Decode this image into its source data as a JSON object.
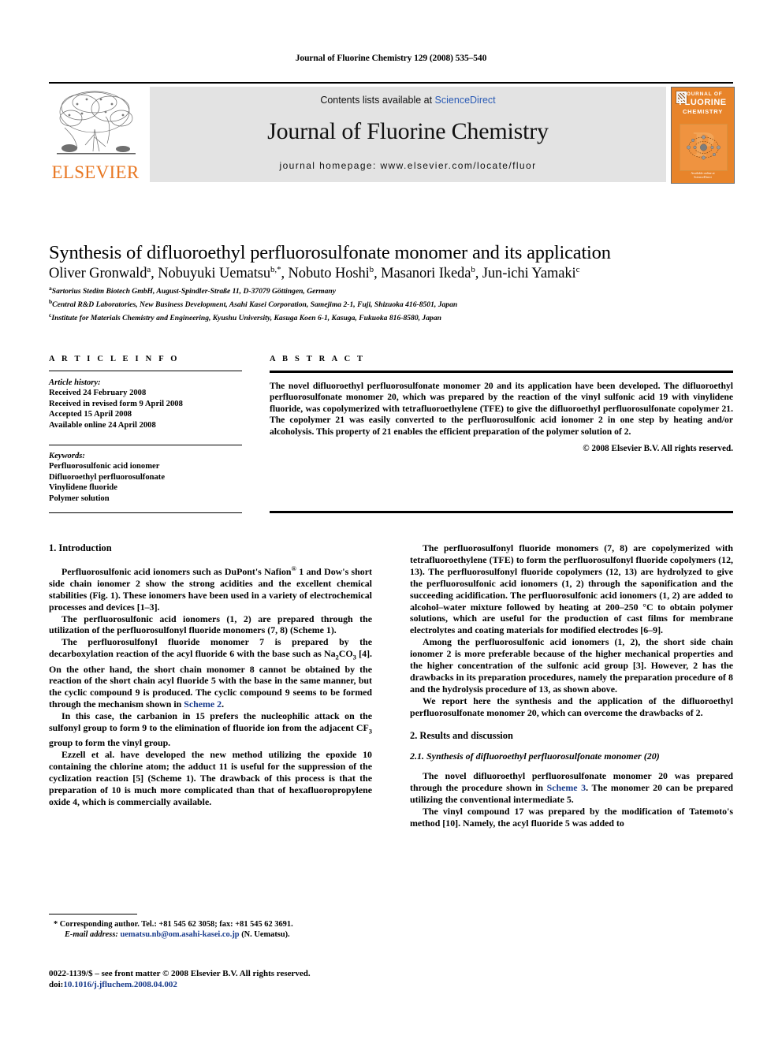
{
  "running_head": "Journal of Fluorine Chemistry 129 (2008) 535–540",
  "masthead": {
    "contents_prefix": "Contents lists available at ",
    "sciencedirect": "ScienceDirect",
    "journal_title": "Journal of Fluorine Chemistry",
    "homepage": "journal homepage: www.elsevier.com/locate/fluor",
    "publisher_wordmark": "ELSEVIER",
    "publisher_color": "#E87722",
    "link_color": "#2b5bb5",
    "band_color": "#e3e3e3",
    "cover": {
      "line1": "JOURNAL OF",
      "line2": "FLUORINE",
      "line3": "CHEMISTRY",
      "background": "#E8842A",
      "foot_line1": "Available online at",
      "foot_line2": "ScienceDirect"
    }
  },
  "article": {
    "title": "Synthesis of difluoroethyl perfluorosulfonate monomer and its application",
    "authors": [
      {
        "name": "Oliver Gronwald",
        "marks": "a",
        "sep": ", "
      },
      {
        "name": "Nobuyuki Uematsu",
        "marks": "b,*",
        "sep": ", "
      },
      {
        "name": "Nobuto Hoshi",
        "marks": "b",
        "sep": ", "
      },
      {
        "name": "Masanori Ikeda",
        "marks": "b",
        "sep": ", "
      },
      {
        "name": "Jun-ichi Yamaki",
        "marks": "c",
        "sep": ""
      }
    ],
    "affiliations": [
      {
        "mark": "a",
        "text": "Sartorius Stedim Biotech GmbH, August-Spindler-Straße 11, D-37079 Göttingen, Germany"
      },
      {
        "mark": "b",
        "text": "Central R&D Laboratories, New Business Development, Asahi Kasei Corporation, Samejima 2-1, Fuji, Shizuoka 416-8501, Japan"
      },
      {
        "mark": "c",
        "text": "Institute for Materials Chemistry and Engineering, Kyushu University, Kasuga Koen 6-1, Kasuga, Fukuoka 816-8580, Japan"
      }
    ]
  },
  "article_info": {
    "heading": "A R T I C L E   I N F O",
    "history_label": "Article history:",
    "history": [
      "Received 24 February 2008",
      "Received in revised form 9 April 2008",
      "Accepted 15 April 2008",
      "Available online 24 April 2008"
    ],
    "keywords_label": "Keywords:",
    "keywords": [
      "Perfluorosulfonic acid ionomer",
      "Difluoroethyl perfluorosulfonate",
      "Vinylidene fluoride",
      "Polymer solution"
    ]
  },
  "abstract": {
    "heading": "A B S T R A C T",
    "text": "The novel difluoroethyl perfluorosulfonate monomer 20 and its application have been developed. The difluoroethyl perfluorosulfonate monomer 20, which was prepared by the reaction of the vinyl sulfonic acid 19 with vinylidene fluoride, was copolymerized with tetrafluoroethylene (TFE) to give the difluoroethyl perfluorosulfonate copolymer 21. The copolymer 21 was easily converted to the perfluorosulfonic acid ionomer 2 in one step by heating and/or alcoholysis. This property of 21 enables the efficient preparation of the polymer solution of 2.",
    "copyright": "© 2008 Elsevier B.V. All rights reserved."
  },
  "body": {
    "left": {
      "section1_heading": "1.  Introduction",
      "p1": "Perfluorosulfonic acid ionomers such as DuPont's Nafion® 1 and Dow's short side chain ionomer 2 show the strong acidities and the excellent chemical stabilities (Fig. 1). These ionomers have been used in a variety of electrochemical processes and devices [1–3].",
      "p2": "The perfluorosulfonic acid ionomers (1, 2) are prepared through the utilization of the perfluorosulfonyl fluoride monomers (7, 8) (Scheme 1).",
      "p3": "The perfluorosulfonyl fluoride monomer 7 is prepared by the decarboxylation reaction of the acyl fluoride 6 with the base such as Na2CO3 [4]. On the other hand, the short chain monomer 8 cannot be obtained by the reaction of the short chain acyl fluoride 5 with the base in the same manner, but the cyclic compound 9 is produced. The cyclic compound 9 seems to be formed through the mechanism shown in Scheme 2.",
      "p4": "In this case, the carbanion in 15 prefers the nucleophilic attack on the sulfonyl group to form 9 to the elimination of fluoride ion from the adjacent CF3 group to form the vinyl group.",
      "p5": "Ezzell et al. have developed the new method utilizing the epoxide 10 containing the chlorine atom; the adduct 11 is useful for the suppression of the cyclization reaction [5] (Scheme 1). The drawback of this process is that the preparation of 10 is much more complicated than that of hexafluoropropylene oxide 4, which is commercially available."
    },
    "right": {
      "p1": "The perfluorosulfonyl fluoride monomers (7, 8) are copolymerized with tetrafluoroethylene (TFE) to form the perfluorosulfonyl fluoride copolymers (12, 13). The perfluorosulfonyl fluoride copolymers (12, 13) are hydrolyzed to give the perfluorosulfonic acid ionomers (1, 2) through the saponification and the succeeding acidification. The perfluorosulfonic acid ionomers (1, 2) are added to alcohol–water mixture followed by heating at 200–250 °C to obtain polymer solutions, which are useful for the production of cast films for membrane electrolytes and coating materials for modified electrodes [6–9].",
      "p2": "Among the perfluorosulfonic acid ionomers (1, 2), the short side chain ionomer 2 is more preferable because of the higher mechanical properties and the higher concentration of the sulfonic acid group [3]. However, 2 has the drawbacks in its preparation procedures, namely the preparation procedure of 8 and the hydrolysis procedure of 13, as shown above.",
      "p3": "We report here the synthesis and the application of the difluoroethyl perfluorosulfonate monomer 20, which can overcome the drawbacks of 2.",
      "section2_heading": "2.  Results and discussion",
      "subsection21_heading": "2.1.  Synthesis of difluoroethyl perfluorosulfonate monomer (20)",
      "p4": "The novel difluoroethyl perfluorosulfonate monomer 20 was prepared through the procedure shown in Scheme 3. The monomer 20 can be prepared utilizing the conventional intermediate 5.",
      "p5": "The vinyl compound 17 was prepared by the modification of Tatemoto's method [10]. Namely, the acyl fluoride 5 was added to"
    }
  },
  "footnote": {
    "line1": "* Corresponding author. Tel.: +81 545 62 3058; fax: +81 545 62 3691.",
    "email_label": "E-mail address:",
    "email": "uematsu.nb@om.asahi-kasei.co.jp",
    "email_suffix": "(N. Uematsu)."
  },
  "footer": {
    "issn_line": "0022-1139/$ – see front matter © 2008 Elsevier B.V. All rights reserved.",
    "doi_label": "doi:",
    "doi": "10.1016/j.jfluchem.2008.04.002"
  }
}
